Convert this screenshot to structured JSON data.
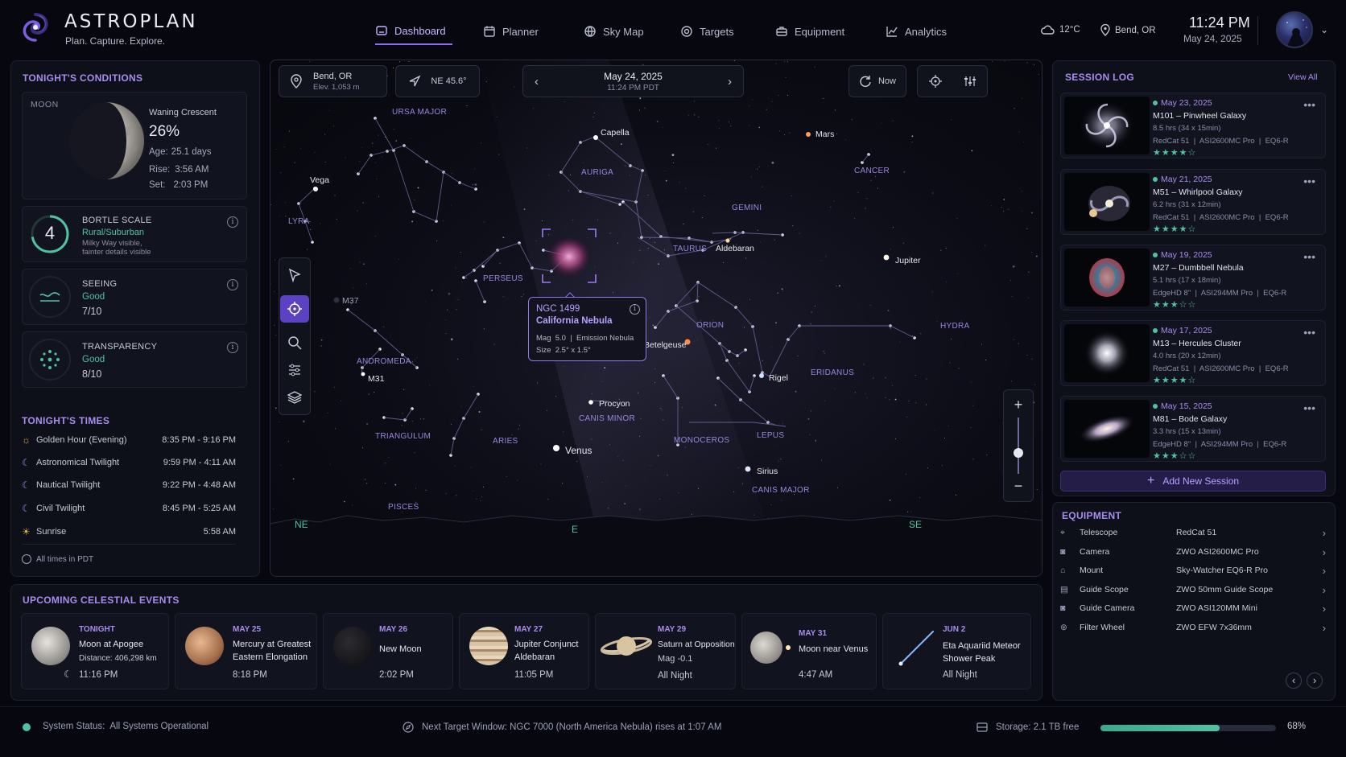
{
  "app": {
    "name": "ASTROPLAN",
    "tagline": "Plan. Capture. Explore."
  },
  "nav": {
    "items": [
      {
        "label": "Dashboard",
        "icon": "dashboard-icon",
        "active": true
      },
      {
        "label": "Planner",
        "icon": "calendar-icon",
        "active": false
      },
      {
        "label": "Sky Map",
        "icon": "globe-icon",
        "active": false
      },
      {
        "label": "Targets",
        "icon": "target-icon",
        "active": false
      },
      {
        "label": "Equipment",
        "icon": "case-icon",
        "active": false
      },
      {
        "label": "Analytics",
        "icon": "chart-icon",
        "active": false
      }
    ]
  },
  "header": {
    "weather": "12°C",
    "location": "Bend, OR",
    "time": "11:24 PM",
    "date": "May 24, 2025"
  },
  "conditions": {
    "title": "TONIGHT'S CONDITIONS",
    "moon": {
      "label": "MOON",
      "phase": "Waning Crescent",
      "illumination": "26%",
      "age_label": "Age:",
      "age": "25.1 days",
      "rise_label": "Rise:",
      "rise": "3:56 AM",
      "set_label": "Set:",
      "set": "2:03 PM"
    },
    "bortle": {
      "value": "4",
      "title": "BORTLE SCALE",
      "class": "Rural/Suburban",
      "note1": "Milky Way visible,",
      "note2": "fainter details visible"
    },
    "seeing": {
      "title": "SEEING",
      "status": "Good",
      "score": "7/10"
    },
    "transparency": {
      "title": "TRANSPARENCY",
      "status": "Good",
      "score": "8/10"
    }
  },
  "times": {
    "title": "TONIGHT'S TIMES",
    "rows": [
      {
        "label": "Golden Hour (Evening)",
        "value": "8:35 PM - 9:16 PM",
        "icon": "sun-icon"
      },
      {
        "label": "Astronomical Twilight",
        "value": "9:59 PM - 4:11 AM",
        "icon": "moon-icon"
      },
      {
        "label": "Nautical Twilight",
        "value": "9:22 PM - 4:48 AM",
        "icon": "moon-icon"
      },
      {
        "label": "Civil Twilight",
        "value": "8:45 PM - 5:25 AM",
        "icon": "moon-icon"
      },
      {
        "label": "Sunrise",
        "value": "5:58 AM",
        "icon": "sunrise-icon"
      }
    ],
    "footnote": "All times in PDT"
  },
  "map": {
    "location": "Bend, OR",
    "elevation": "Elev. 1,053 m",
    "direction": "NE 45.6°",
    "date": "May 24, 2025",
    "time": "11:24 PM PDT",
    "now_label": "Now",
    "constellations": [
      "URSA MAJOR",
      "AURIGA",
      "CANCER",
      "LYRA",
      "GEMINI",
      "TAURUS",
      "PERSEUS",
      "ORION",
      "HYDRA",
      "ANDROMEDA",
      "ERIDANUS",
      "CANIS MINOR",
      "TRIANGULUM",
      "ARIES",
      "MONOCEROS",
      "LEPUS",
      "CANIS MAJOR",
      "PISCES"
    ],
    "stars": [
      "Capella",
      "Mars",
      "Vega",
      "Aldebaran",
      "Jupiter",
      "M37",
      "Betelgeuse",
      "M31",
      "Rigel",
      "Procyon",
      "Venus",
      "Sirius"
    ],
    "horizon": {
      "left": "NE",
      "center": "E",
      "right": "SE"
    },
    "popup": {
      "name": "NGC 1499",
      "common": "California Nebula",
      "mag": "Mag  5.0  |  Emission Nebula",
      "size": "Size  2.5° x 1.5°"
    }
  },
  "session_log": {
    "title": "SESSION LOG",
    "view_all": "View All",
    "items": [
      {
        "date": "May 23, 2025",
        "title": "M101 – Pinwheel Galaxy",
        "duration": "8.5 hrs (34 x 15min)",
        "gear": "RedCat 51  |  ASI2600MC Pro  |  EQ6-R",
        "rating": "★★★★☆",
        "thumb": "spiral"
      },
      {
        "date": "May 21, 2025",
        "title": "M51 – Whirlpool Galaxy",
        "duration": "6.2 hrs (31 x 12min)",
        "gear": "RedCat 51  |  ASI2600MC Pro  |  EQ6-R",
        "rating": "★★★★☆",
        "thumb": "whirl"
      },
      {
        "date": "May 19, 2025",
        "title": "M27 – Dumbbell Nebula",
        "duration": "5.1 hrs (17 x 18min)",
        "gear": "EdgeHD 8\"  |  ASI294MM Pro  |  EQ6-R",
        "rating": "★★★☆☆",
        "thumb": "nebula"
      },
      {
        "date": "May 17, 2025",
        "title": "M13 – Hercules Cluster",
        "duration": "4.0 hrs (20 x 12min)",
        "gear": "RedCat 51  |  ASI2600MC Pro  |  EQ6-R",
        "rating": "★★★★☆",
        "thumb": "cluster"
      },
      {
        "date": "May 15, 2025",
        "title": "M81 – Bode Galaxy",
        "duration": "3.3 hrs (15 x 13min)",
        "gear": "EdgeHD 8\"  |  ASI294MM Pro  |  EQ6-R",
        "rating": "★★★☆☆",
        "thumb": "elliptic"
      }
    ],
    "add_label": "Add New Session"
  },
  "equipment": {
    "title": "EQUIPMENT",
    "rows": [
      {
        "label": "Telescope",
        "value": "RedCat 51",
        "icon": "telescope-icon"
      },
      {
        "label": "Camera",
        "value": "ZWO ASI2600MC Pro",
        "icon": "camera-icon"
      },
      {
        "label": "Mount",
        "value": "Sky-Watcher EQ6-R Pro",
        "icon": "mount-icon"
      },
      {
        "label": "Guide Scope",
        "value": "ZWO 50mm Guide Scope",
        "icon": "guidescope-icon"
      },
      {
        "label": "Guide Camera",
        "value": "ZWO ASI120MM Mini",
        "icon": "guidecam-icon"
      },
      {
        "label": "Filter Wheel",
        "value": "ZWO EFW 7x36mm",
        "icon": "filterwheel-icon"
      }
    ]
  },
  "events": {
    "title": "UPCOMING CELESTIAL EVENTS",
    "items": [
      {
        "date": "TONIGHT",
        "title": "Moon at Apogee",
        "sub": "Distance: 406,298 km",
        "time": "11:16 PM"
      },
      {
        "date": "MAY 25",
        "title": "Mercury at Greatest Eastern Elongation",
        "sub": "",
        "time": "8:18 PM"
      },
      {
        "date": "MAY 26",
        "title": "New Moon",
        "sub": "",
        "time": "2:02 PM"
      },
      {
        "date": "MAY 27",
        "title": "Jupiter Conjunct Aldebaran",
        "sub": "",
        "time": "11:05 PM"
      },
      {
        "date": "MAY 29",
        "title": "Saturn at Opposition",
        "sub": "Mag -0.1",
        "time": "All Night"
      },
      {
        "date": "MAY 31",
        "title": "Moon near Venus",
        "sub": "",
        "time": "4:47 AM"
      },
      {
        "date": "JUN 2",
        "title": "Eta Aquariid Meteor Shower Peak",
        "sub": "",
        "time": "All Night"
      }
    ]
  },
  "footer": {
    "status_label": "System Status:",
    "status": "All Systems Operational",
    "next_window": "Next Target Window:  NGC 7000 (North America Nebula) rises at 1:07 AM",
    "storage": "Storage:  2.1 TB free",
    "storage_pct": "68%",
    "storage_fraction": 0.68
  },
  "colors": {
    "accent": "#8b6cf5",
    "accent_text": "#a98cf0",
    "good": "#4fc3a1",
    "bg": "#07080f"
  }
}
